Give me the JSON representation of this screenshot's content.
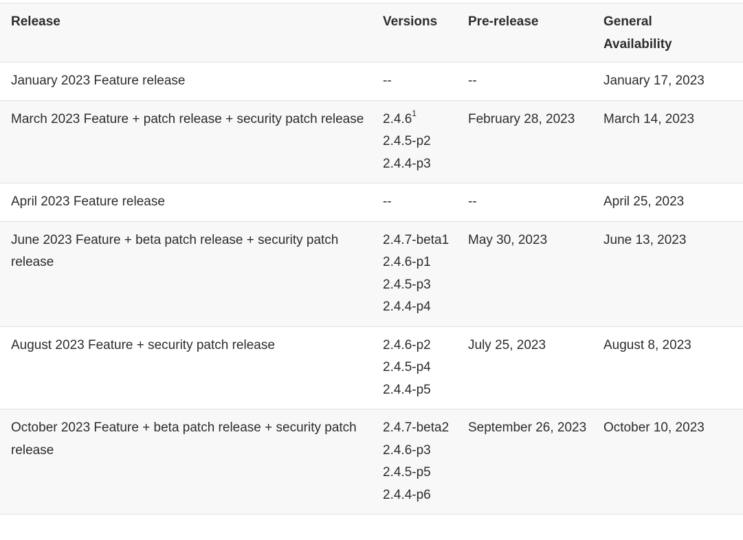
{
  "headers": {
    "release": "Release",
    "versions": "Versions",
    "prerelease": "Pre-release",
    "ga_line1": "General",
    "ga_line2": "Availability"
  },
  "rows": [
    {
      "release": "January 2023 Feature release",
      "versions": [
        "--"
      ],
      "prerelease": "--",
      "ga": "January 17, 2023"
    },
    {
      "release": "March 2023 Feature + patch release + security patch release",
      "versions": [
        "2.4.6",
        "2.4.5-p2",
        "2.4.4-p3"
      ],
      "versions_footnote": "1",
      "prerelease": "February 28, 2023",
      "ga": "March 14, 2023"
    },
    {
      "release": "April 2023 Feature release",
      "versions": [
        "--"
      ],
      "prerelease": "--",
      "ga": "April 25, 2023"
    },
    {
      "release": "June 2023 Feature + beta patch release + security patch release",
      "versions": [
        "2.4.7-beta1",
        "2.4.6-p1",
        "2.4.5-p3",
        "2.4.4-p4"
      ],
      "prerelease": "May 30, 2023",
      "ga": "June 13, 2023"
    },
    {
      "release": "August 2023 Feature + security patch release",
      "versions": [
        "2.4.6-p2",
        "2.4.5-p4",
        "2.4.4-p5"
      ],
      "prerelease": "July 25, 2023",
      "ga": "August 8, 2023"
    },
    {
      "release": "October 2023 Feature + beta patch release + security patch release",
      "versions": [
        "2.4.7-beta2",
        "2.4.6-p3",
        "2.4.5-p5",
        "2.4.4-p6"
      ],
      "prerelease": "September 26, 2023",
      "ga": "October 10, 2023"
    }
  ]
}
